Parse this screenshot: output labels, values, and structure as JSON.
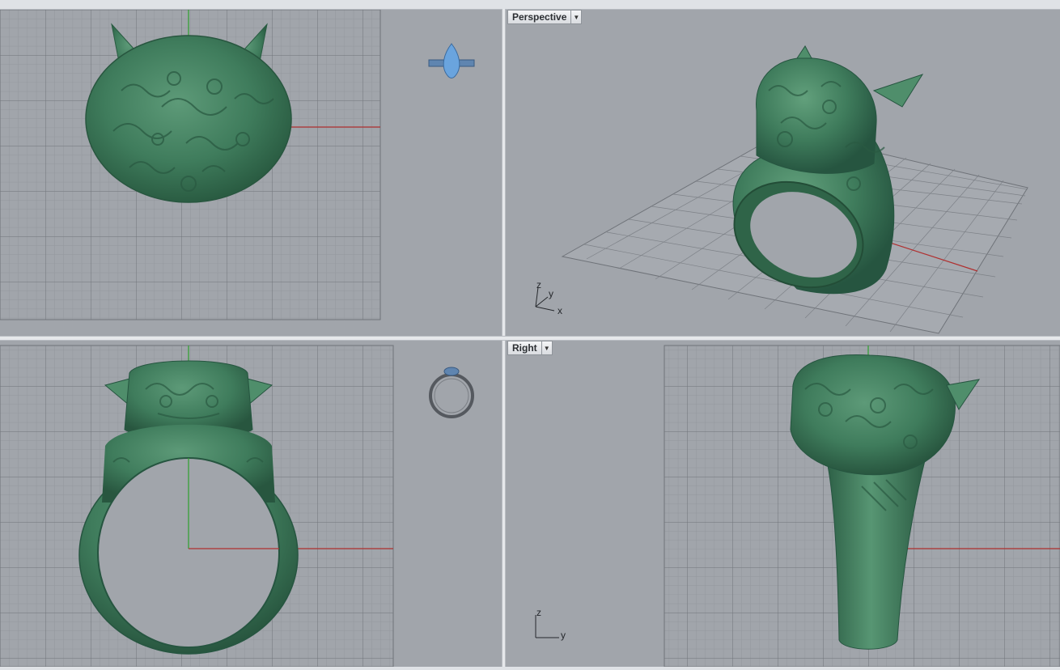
{
  "viewports": {
    "top": {
      "title": ""
    },
    "perspective": {
      "title": "Perspective",
      "menu_icon": "dropdown-arrow-icon"
    },
    "front": {
      "title": ""
    },
    "right": {
      "title": "Right",
      "menu_icon": "dropdown-arrow-icon"
    }
  },
  "axis_labels": {
    "perspective": {
      "z": "z",
      "y": "y",
      "x": "x"
    },
    "right": {
      "z": "z",
      "y": "y"
    }
  },
  "colors": {
    "viewport_bg": "#a1a5ab",
    "grid_minor": "#8f9399",
    "grid_major": "#6f7379",
    "model_green": "#3d7a5a",
    "x_axis": "#b03030",
    "y_axis": "#2da02d",
    "gem_blue": "#5f9bd8"
  }
}
